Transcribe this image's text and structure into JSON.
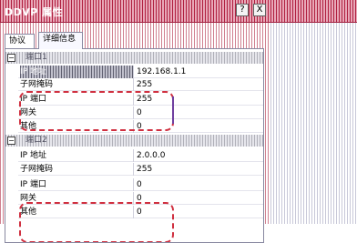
{
  "window": {
    "title": "DDVP 属性",
    "help_glyph": "?",
    "close_glyph": "X"
  },
  "tabs": [
    {
      "label": "协议"
    },
    {
      "label": "详细信息"
    }
  ],
  "groups": [
    {
      "label": "端口1",
      "expander": "−",
      "rows": [
        {
          "prop": "IP 地址",
          "value": "192.168.1.1"
        },
        {
          "prop": "子网掩码",
          "value": "255"
        },
        {
          "prop": "IP 端口",
          "value": "255"
        },
        {
          "prop": "网关",
          "value": "0"
        },
        {
          "prop": "其他",
          "value": "0"
        }
      ]
    },
    {
      "label": "端口2",
      "expander": "−",
      "rows": [
        {
          "prop": "IP 地址",
          "value": "2.0.0.0"
        },
        {
          "prop": "子网掩码",
          "value": "255"
        },
        {
          "prop": "IP 端口",
          "value": "0"
        },
        {
          "prop": "网关",
          "value": "0"
        },
        {
          "prop": "其他",
          "value": "0"
        }
      ]
    }
  ],
  "colors": {
    "title_bar": "#b02040",
    "highlight_outline": "#d03040",
    "accent_mark": "#7040a0"
  }
}
